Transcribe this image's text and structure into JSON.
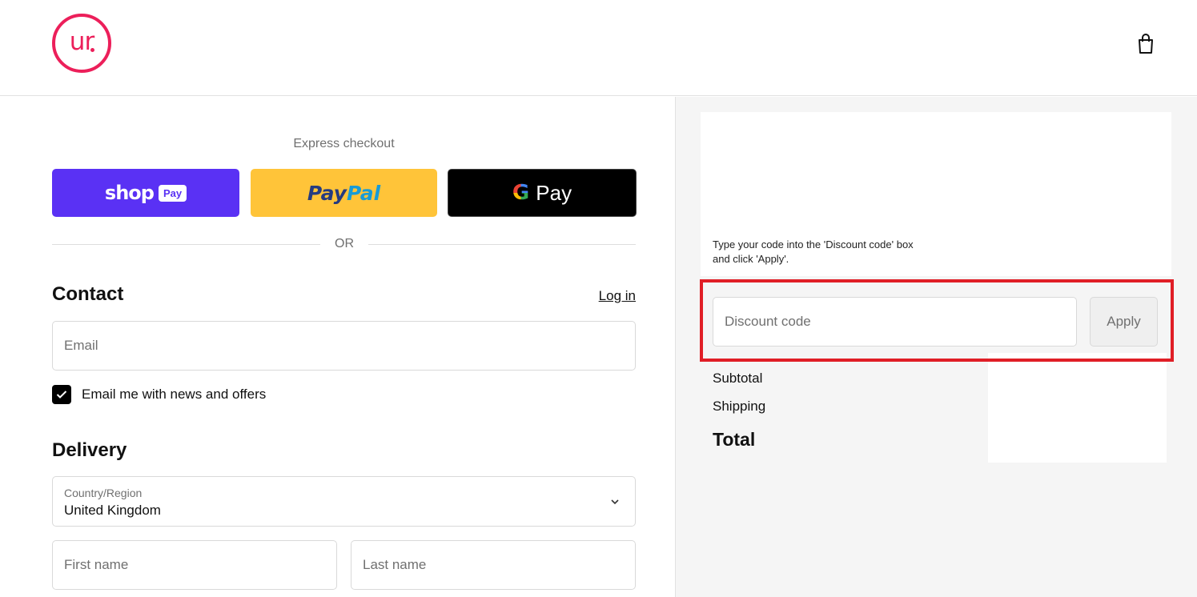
{
  "brand": {
    "logo_text": "ur",
    "accent": "#ec1f5a"
  },
  "header": {
    "cart_icon": "shopping-bag-icon"
  },
  "express": {
    "title": "Express checkout",
    "shop_pay": {
      "word": "shop",
      "badge": "Pay",
      "color": "#5a31f4"
    },
    "paypal": {
      "word_1": "Pay",
      "word_2": "Pal",
      "color": "#ffc439"
    },
    "google_pay": {
      "g": "G",
      "word": "Pay",
      "color": "#000000"
    },
    "or_text": "OR"
  },
  "contact": {
    "heading": "Contact",
    "login_label": "Log in",
    "email_placeholder": "Email",
    "newsletter_label": "Email me with news and offers",
    "newsletter_checked": true
  },
  "delivery": {
    "heading": "Delivery",
    "country_caption": "Country/Region",
    "country_value": "United Kingdom",
    "first_name_placeholder": "First name",
    "last_name_placeholder": "Last name"
  },
  "summary": {
    "promo_text": "Type your code into the 'Discount code' box and click 'Apply'.",
    "discount_placeholder": "Discount code",
    "apply_label": "Apply",
    "highlight_color": "#e01e26",
    "subtotal_label": "Subtotal",
    "shipping_label": "Shipping",
    "total_label": "Total"
  }
}
